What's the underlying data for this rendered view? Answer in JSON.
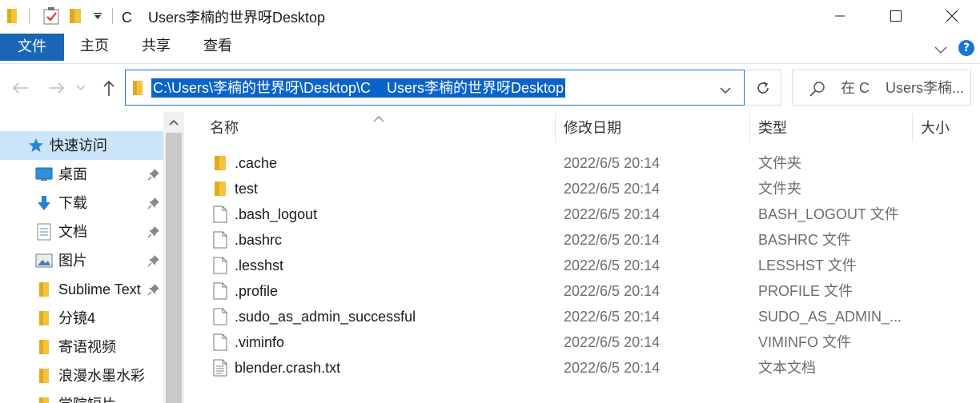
{
  "titlebar": {
    "title": "C    Users李楠的世界呀Desktop",
    "icons": [
      "folder-icon",
      "properties-icon",
      "new-folder-icon",
      "customize-dropdown-icon"
    ],
    "window_buttons": [
      "minimize",
      "maximize",
      "close"
    ]
  },
  "ribbon": {
    "tabs": [
      {
        "label": "文件",
        "active": true
      },
      {
        "label": "主页"
      },
      {
        "label": "共享"
      },
      {
        "label": "查看"
      }
    ],
    "accent": "#1a65b6"
  },
  "address": {
    "path": "C:\\Users\\李楠的世界呀\\Desktop\\C    Users李楠的世界呀Desktop",
    "search_placeholder": "在 C    Users李楠..."
  },
  "nav": {
    "quick_access": "快速访问",
    "items": [
      {
        "label": "桌面",
        "icon": "desktop-icon",
        "pinned": true
      },
      {
        "label": "下载",
        "icon": "download-icon",
        "pinned": true
      },
      {
        "label": "文档",
        "icon": "document-icon",
        "pinned": true
      },
      {
        "label": "图片",
        "icon": "pictures-icon",
        "pinned": true
      },
      {
        "label": "Sublime Text",
        "icon": "folder-icon",
        "pinned": true
      },
      {
        "label": "分镜4",
        "icon": "folder-icon",
        "pinned": false
      },
      {
        "label": "寄语视频",
        "icon": "folder-icon",
        "pinned": false
      },
      {
        "label": "浪漫水墨水彩晕染",
        "icon": "folder-icon",
        "pinned": false
      },
      {
        "label": "学院短片",
        "icon": "folder-icon",
        "pinned": false
      }
    ]
  },
  "columns": {
    "name": "名称",
    "date": "修改日期",
    "type": "类型",
    "size": "大小"
  },
  "files": [
    {
      "name": ".cache",
      "date": "2022/6/5 20:14",
      "type": "文件夹",
      "kind": "folder"
    },
    {
      "name": "test",
      "date": "2022/6/5 20:14",
      "type": "文件夹",
      "kind": "folder"
    },
    {
      "name": ".bash_logout",
      "date": "2022/6/5 20:14",
      "type": "BASH_LOGOUT 文件",
      "kind": "file"
    },
    {
      "name": ".bashrc",
      "date": "2022/6/5 20:14",
      "type": "BASHRC 文件",
      "kind": "file"
    },
    {
      "name": ".lesshst",
      "date": "2022/6/5 20:14",
      "type": "LESSHST 文件",
      "kind": "file"
    },
    {
      "name": ".profile",
      "date": "2022/6/5 20:14",
      "type": "PROFILE 文件",
      "kind": "file"
    },
    {
      "name": ".sudo_as_admin_successful",
      "date": "2022/6/5 20:14",
      "type": "SUDO_AS_ADMIN_...",
      "kind": "file"
    },
    {
      "name": ".viminfo",
      "date": "2022/6/5 20:14",
      "type": "VIMINFO 文件",
      "kind": "file"
    },
    {
      "name": "blender.crash.txt",
      "date": "2022/6/5 20:14",
      "type": "文本文档",
      "kind": "text"
    }
  ]
}
